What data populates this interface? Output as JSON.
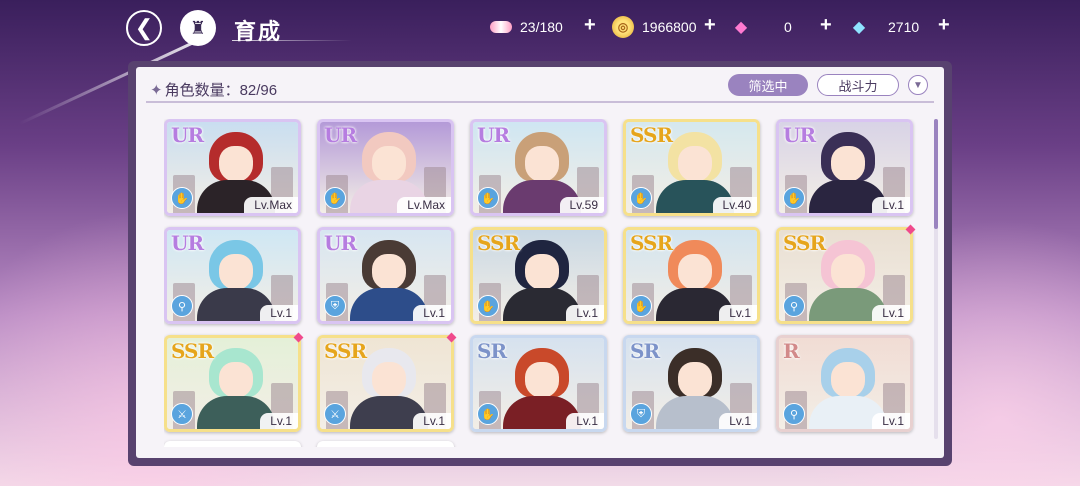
{
  "header": {
    "title": "育成",
    "back_icon": "back-arrow-icon",
    "home_icon": "castle-icon"
  },
  "resources": [
    {
      "name": "candy",
      "icon": "candy-icon",
      "value": "23/180"
    },
    {
      "name": "coin",
      "icon": "coin-icon",
      "value": "1966800"
    },
    {
      "name": "gem",
      "icon": "pink-diamond-icon",
      "value": "0"
    },
    {
      "name": "diamond",
      "icon": "blue-diamond-icon",
      "value": "2710"
    }
  ],
  "toolbar": {
    "count_label": "角色数量：82/96",
    "filter_label": "筛选中",
    "sort_label": "战斗力",
    "sort_toggle_icon": "chevron-down-icon"
  },
  "cards": [
    {
      "rarity": "UR",
      "level": "Lv.Max",
      "type_icon": "glove-icon",
      "hair": "#b52c2c",
      "body": "#2b2328",
      "sky": "#c9def0",
      "new": false
    },
    {
      "rarity": "UR",
      "level": "Lv.Max",
      "type_icon": "glove-icon",
      "hair": "#f2c9c0",
      "body": "#e9d4e4",
      "sky": "#b49ad8",
      "new": false
    },
    {
      "rarity": "UR",
      "level": "Lv.59",
      "type_icon": "glove-icon",
      "hair": "#c9a078",
      "body": "#6a3b6f",
      "sky": "#cfe6f2",
      "new": false
    },
    {
      "rarity": "SSR",
      "level": "Lv.40",
      "type_icon": "glove-icon",
      "hair": "#f3e2a3",
      "body": "#28535a",
      "sky": "#d5e8ee",
      "new": false
    },
    {
      "rarity": "UR",
      "level": "Lv.1",
      "type_icon": "glove-icon",
      "hair": "#3a2f56",
      "body": "#2a2540",
      "sky": "#d8d3e6",
      "new": false
    },
    {
      "rarity": "UR",
      "level": "Lv.1",
      "type_icon": "wand-icon",
      "hair": "#7ac7e6",
      "body": "#3a3a4a",
      "sky": "#cfe7f4",
      "new": false
    },
    {
      "rarity": "UR",
      "level": "Lv.1",
      "type_icon": "shield-icon",
      "hair": "#4a3b35",
      "body": "#2d4d8a",
      "sky": "#d7e6f1",
      "new": false
    },
    {
      "rarity": "SSR",
      "level": "Lv.1",
      "type_icon": "glove-icon",
      "hair": "#1f2540",
      "body": "#2a2a33",
      "sky": "#c9d8e4",
      "new": false
    },
    {
      "rarity": "SSR",
      "level": "Lv.1",
      "type_icon": "glove-icon",
      "hair": "#f08a5a",
      "body": "#2a2833",
      "sky": "#d2e4ef",
      "new": false
    },
    {
      "rarity": "SSR",
      "level": "Lv.1",
      "type_icon": "wand-icon",
      "hair": "#f5c4d4",
      "body": "#7a9a7a",
      "sky": "#e9dfd2",
      "new": true
    },
    {
      "rarity": "SSR",
      "level": "Lv.1",
      "type_icon": "sword-icon",
      "hair": "#a8e6cf",
      "body": "#3d5f5a",
      "sky": "#e4f0d8",
      "new": true
    },
    {
      "rarity": "SSR",
      "level": "Lv.1",
      "type_icon": "sword-icon",
      "hair": "#e8e8ee",
      "body": "#3e3e4e",
      "sky": "#efe5d4",
      "new": true
    },
    {
      "rarity": "SR",
      "level": "Lv.1",
      "type_icon": "glove-icon",
      "hair": "#c9492a",
      "body": "#7a1f25",
      "sky": "#d6e2ef",
      "new": false
    },
    {
      "rarity": "SR",
      "level": "Lv.1",
      "type_icon": "shield-icon",
      "hair": "#3b2e28",
      "body": "#b7bfcc",
      "sky": "#d6e2ef",
      "new": false
    },
    {
      "rarity": "R",
      "level": "Lv.1",
      "type_icon": "wand-icon",
      "hair": "#a8d0ea",
      "body": "#e9f0f6",
      "sky": "#f1dcd4",
      "new": false
    }
  ]
}
